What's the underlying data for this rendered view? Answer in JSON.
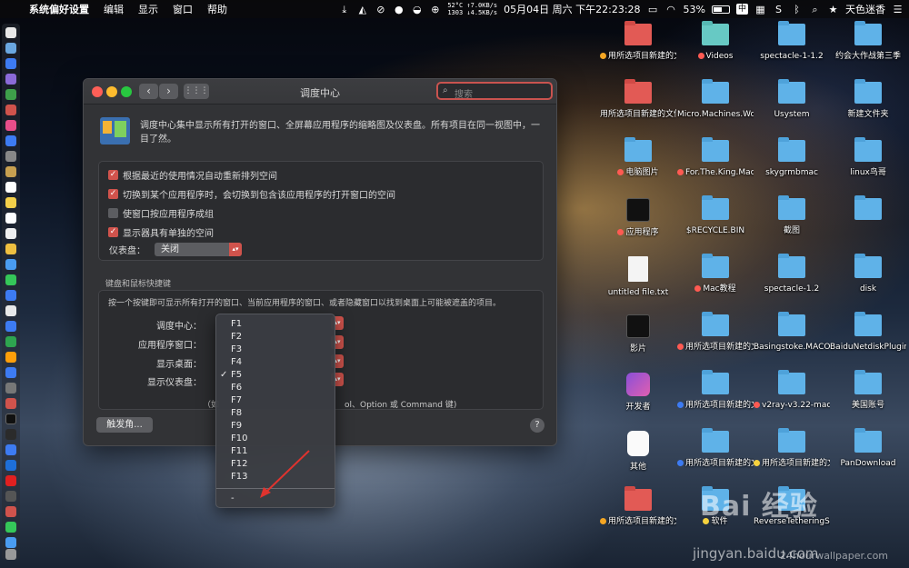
{
  "menubar": {
    "app_name": "系统偏好设置",
    "menus": [
      "编辑",
      "显示",
      "窗口",
      "帮助"
    ],
    "net_up": "52°C ↑7.0KB/s",
    "net_down": "1303 ↓4.5KB/s",
    "datetime": "05月04日 周六 下午22:23:28",
    "battery": "53%",
    "ime": "中",
    "user": "天色迷香"
  },
  "window": {
    "title": "调度中心",
    "search_placeholder": "搜索",
    "intro": "调度中心集中显示所有打开的窗口、全屏幕应用程序的缩略图及仪表盘。所有项目在同一视图中，一目了然。",
    "options": [
      {
        "label": "根据最近的使用情况自动重新排列空间",
        "checked": true
      },
      {
        "label": "切换到某个应用程序时，会切换到包含该应用程序的打开窗口的空间",
        "checked": true
      },
      {
        "label": "使窗口按应用程序成组",
        "checked": false
      },
      {
        "label": "显示器具有单独的空间",
        "checked": true
      }
    ],
    "dashboard_label": "仪表盘：",
    "dashboard_value": "关闭",
    "shortcuts_section": "键盘和鼠标快捷键",
    "shortcuts_desc": "按一个按键即可显示所有打开的窗口、当前应用程序的窗口、或者隐藏窗口以找到桌面上可能被遮盖的项目。",
    "shortcut_rows": [
      "调度中心：",
      "应用程序窗口：",
      "显示桌面：",
      "显示仪表盘："
    ],
    "note_left": "（如",
    "note_right": "ol、Option 或 Command 键)",
    "hot_corners": "触发角...",
    "help": "?"
  },
  "dropdown": {
    "options": [
      "F1",
      "F2",
      "F3",
      "F4",
      "F5",
      "F6",
      "F7",
      "F8",
      "F9",
      "F10",
      "F11",
      "F12",
      "F13"
    ],
    "selected": "F5",
    "dash_option": "-"
  },
  "desktop": {
    "items": [
      {
        "label": "用所选项目新建的文件夹 5",
        "tag": "orange",
        "icon": "red-folder"
      },
      {
        "label": "Videos",
        "tag": "red",
        "icon": "teal-folder"
      },
      {
        "label": "spectacle-1-1.2",
        "tag": "",
        "icon": "folder"
      },
      {
        "label": "约会大作战第三季",
        "tag": "",
        "icon": "folder"
      },
      {
        "label": "用所选项目新建的文件夹 4",
        "tag": "",
        "icon": "red-folder"
      },
      {
        "label": "Micro.Machines.Worl...iVATED",
        "tag": "",
        "icon": "folder"
      },
      {
        "label": "Usystem",
        "tag": "",
        "icon": "folder"
      },
      {
        "label": "新建文件夹",
        "tag": "",
        "icon": "folder"
      },
      {
        "label": "电脑图片",
        "tag": "red",
        "icon": "folder"
      },
      {
        "label": "For.The.King.MacOS...iVATED",
        "tag": "red",
        "icon": "folder"
      },
      {
        "label": "skygrmbmac",
        "tag": "",
        "icon": "folder"
      },
      {
        "label": "linux鸟哥",
        "tag": "",
        "icon": "folder"
      },
      {
        "label": "应用程序",
        "tag": "red",
        "icon": "black-app"
      },
      {
        "label": "$RECYCLE.BIN",
        "tag": "",
        "icon": "folder"
      },
      {
        "label": "截图",
        "tag": "",
        "icon": "folder"
      },
      {
        "label": "",
        "tag": "",
        "icon": "folder"
      },
      {
        "label": "untitled file.txt",
        "tag": "",
        "icon": "document"
      },
      {
        "label": "Mac教程",
        "tag": "red",
        "icon": "folder"
      },
      {
        "label": "spectacle-1.2",
        "tag": "",
        "icon": "folder"
      },
      {
        "label": "disk",
        "tag": "",
        "icon": "folder"
      },
      {
        "label": "影片",
        "tag": "",
        "icon": "black-app"
      },
      {
        "label": "用所选项目新建的文件 9",
        "tag": "red",
        "icon": "folder"
      },
      {
        "label": "Basingstoke.MACOSX-GOG",
        "tag": "",
        "icon": "folder"
      },
      {
        "label": "BaiduNetdiskPlugin-ma...-master",
        "tag": "",
        "icon": "folder"
      },
      {
        "label": "开发者",
        "tag": "",
        "icon": "purple-app"
      },
      {
        "label": "用所选项目新建的文件夹 7",
        "tag": "blue",
        "icon": "folder"
      },
      {
        "label": "v2ray-v3.22-macos",
        "tag": "red",
        "icon": "folder"
      },
      {
        "label": "美国账号",
        "tag": "",
        "icon": "folder"
      },
      {
        "label": "其他",
        "tag": "",
        "icon": "white-app"
      },
      {
        "label": "用所选项目新建的文件夹 3",
        "tag": "blue",
        "icon": "folder"
      },
      {
        "label": "用所选项目新建的文件夹 13",
        "tag": "yellow",
        "icon": "folder"
      },
      {
        "label": "PanDownload",
        "tag": "",
        "icon": "folder"
      },
      {
        "label": "用所选项目新建的文件夹 6",
        "tag": "orange",
        "icon": "red-folder"
      },
      {
        "label": "软件",
        "tag": "yellow",
        "icon": "folder"
      },
      {
        "label": "ReverseTetheringServer_1.2.0",
        "tag": "",
        "icon": "folder"
      }
    ]
  },
  "watermarks": {
    "baidu": "Bai 经验",
    "baidu_url": "jingyan.baidu.com",
    "wallpaper": "24hourwallpaper.com"
  }
}
